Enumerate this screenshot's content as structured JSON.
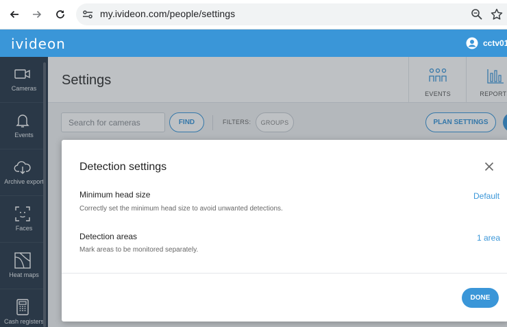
{
  "browser": {
    "url": "my.ivideon.com/people/settings",
    "icons": [
      "back-arrow-icon",
      "forward-arrow-icon",
      "reload-icon",
      "site-settings-icon",
      "zoom-icon",
      "bookmark-star-icon"
    ]
  },
  "app": {
    "logo": "ivideon",
    "user_name": "cctv01",
    "accent_color": "#3a96d8"
  },
  "sidebar": {
    "items": [
      {
        "label": "Cameras",
        "icon": "camera-icon"
      },
      {
        "label": "Events",
        "icon": "bell-icon"
      },
      {
        "label": "Archive export",
        "icon": "cloud-download-icon"
      },
      {
        "label": "Faces",
        "icon": "face-scan-icon"
      },
      {
        "label": "Heat maps",
        "icon": "heat-map-icon"
      },
      {
        "label": "Cash registers",
        "icon": "cash-register-icon"
      }
    ]
  },
  "page": {
    "title": "Settings",
    "tabs": [
      {
        "label": "EVENTS",
        "icon": "people-events-icon"
      },
      {
        "label": "REPORTS",
        "icon": "bar-chart-icon"
      }
    ]
  },
  "toolbar": {
    "search_placeholder": "Search for cameras",
    "find_label": "FIND",
    "filters_label": "FILTERS:",
    "groups_label": "GROUPS",
    "plan_settings_label": "PLAN SETTINGS"
  },
  "modal": {
    "title": "Detection settings",
    "rows": [
      {
        "title": "Minimum head size",
        "description": "Correctly set the minimum head size to avoid unwanted detections.",
        "value": "Default"
      },
      {
        "title": "Detection areas",
        "description": "Mark areas to be monitored separately.",
        "value": "1 area"
      }
    ],
    "done_label": "DONE"
  }
}
